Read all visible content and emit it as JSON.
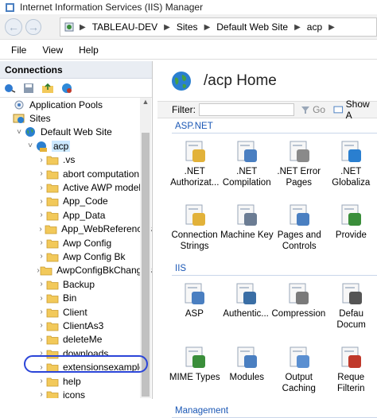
{
  "window": {
    "title": "Internet Information Services (IIS) Manager"
  },
  "address": {
    "back_icon": "back-arrow-icon",
    "forward_icon": "forward-arrow-icon",
    "crumbs": [
      "TABLEAU-DEV",
      "Sites",
      "Default Web Site",
      "acp"
    ]
  },
  "menu": {
    "file": "File",
    "view": "View",
    "help": "Help"
  },
  "connections": {
    "title": "Connections",
    "tree": [
      {
        "label": "Application Pools",
        "icon": "app-pool-icon",
        "expander": "",
        "indent": 0
      },
      {
        "label": "Sites",
        "icon": "sites-icon",
        "expander": "",
        "indent": 0
      },
      {
        "label": "Default Web Site",
        "icon": "globe-icon",
        "expander": "v",
        "indent": 1
      },
      {
        "label": "acp",
        "icon": "app-icon",
        "expander": "v",
        "indent": 2,
        "selected": true
      },
      {
        "label": ".vs",
        "icon": "folder-icon",
        "expander": ">",
        "indent": 3
      },
      {
        "label": "abort computation",
        "icon": "folder-icon",
        "expander": ">",
        "indent": 3
      },
      {
        "label": "Active AWP models",
        "icon": "folder-icon",
        "expander": ">",
        "indent": 3
      },
      {
        "label": "App_Code",
        "icon": "folder-icon",
        "expander": ">",
        "indent": 3
      },
      {
        "label": "App_Data",
        "icon": "folder-icon",
        "expander": ">",
        "indent": 3
      },
      {
        "label": "App_WebReferences",
        "icon": "folder-icon",
        "expander": ">",
        "indent": 3
      },
      {
        "label": "Awp Config",
        "icon": "folder-icon",
        "expander": ">",
        "indent": 3
      },
      {
        "label": "Awp Config Bk",
        "icon": "folder-icon",
        "expander": ">",
        "indent": 3
      },
      {
        "label": "AwpConfigBkChanges",
        "icon": "folder-icon",
        "expander": ">",
        "indent": 3
      },
      {
        "label": "Backup",
        "icon": "folder-icon",
        "expander": ">",
        "indent": 3
      },
      {
        "label": "Bin",
        "icon": "folder-icon",
        "expander": ">",
        "indent": 3
      },
      {
        "label": "Client",
        "icon": "folder-icon",
        "expander": ">",
        "indent": 3
      },
      {
        "label": "ClientAs3",
        "icon": "folder-icon",
        "expander": ">",
        "indent": 3
      },
      {
        "label": "deleteMe",
        "icon": "folder-icon",
        "expander": ">",
        "indent": 3
      },
      {
        "label": "downloads",
        "icon": "folder-icon",
        "expander": ">",
        "indent": 3
      },
      {
        "label": "extensionsexample",
        "icon": "folder-icon",
        "expander": ">",
        "indent": 3,
        "highlighted": true
      },
      {
        "label": "help",
        "icon": "folder-icon",
        "expander": ">",
        "indent": 3
      },
      {
        "label": "icons",
        "icon": "folder-icon",
        "expander": ">",
        "indent": 3
      }
    ]
  },
  "home": {
    "title": "/acp Home",
    "filter_label": "Filter:",
    "go_label": "Go",
    "show_all_label": "Show A",
    "sections": [
      {
        "title": "ASP.NET",
        "rows": [
          [
            {
              "label": ".NET\nAuthorizat...",
              "icon": "net-authorization-icon"
            },
            {
              "label": ".NET\nCompilation",
              "icon": "net-compilation-icon"
            },
            {
              "label": ".NET Error\nPages",
              "icon": "net-error-pages-icon"
            },
            {
              "label": ".NET\nGlobaliza",
              "icon": "net-globalization-icon"
            }
          ],
          [
            {
              "label": "Connection\nStrings",
              "icon": "connection-strings-icon"
            },
            {
              "label": "Machine Key",
              "icon": "machine-key-icon"
            },
            {
              "label": "Pages and\nControls",
              "icon": "pages-controls-icon"
            },
            {
              "label": "Provide",
              "icon": "providers-icon"
            }
          ]
        ]
      },
      {
        "title": "IIS",
        "rows": [
          [
            {
              "label": "ASP",
              "icon": "asp-icon"
            },
            {
              "label": "Authentic...",
              "icon": "authentication-icon"
            },
            {
              "label": "Compression",
              "icon": "compression-icon"
            },
            {
              "label": "Defau\nDocum",
              "icon": "default-document-icon"
            }
          ],
          [
            {
              "label": "MIME Types",
              "icon": "mime-types-icon"
            },
            {
              "label": "Modules",
              "icon": "modules-icon"
            },
            {
              "label": "Output\nCaching",
              "icon": "output-caching-icon"
            },
            {
              "label": "Reque\nFilterin",
              "icon": "request-filtering-icon"
            }
          ]
        ]
      },
      {
        "title": "Management",
        "rows": []
      }
    ]
  },
  "colors": {
    "accent": "#1a57b5",
    "highlight_oval": "#2b45d8",
    "selection": "#cce8ff"
  }
}
